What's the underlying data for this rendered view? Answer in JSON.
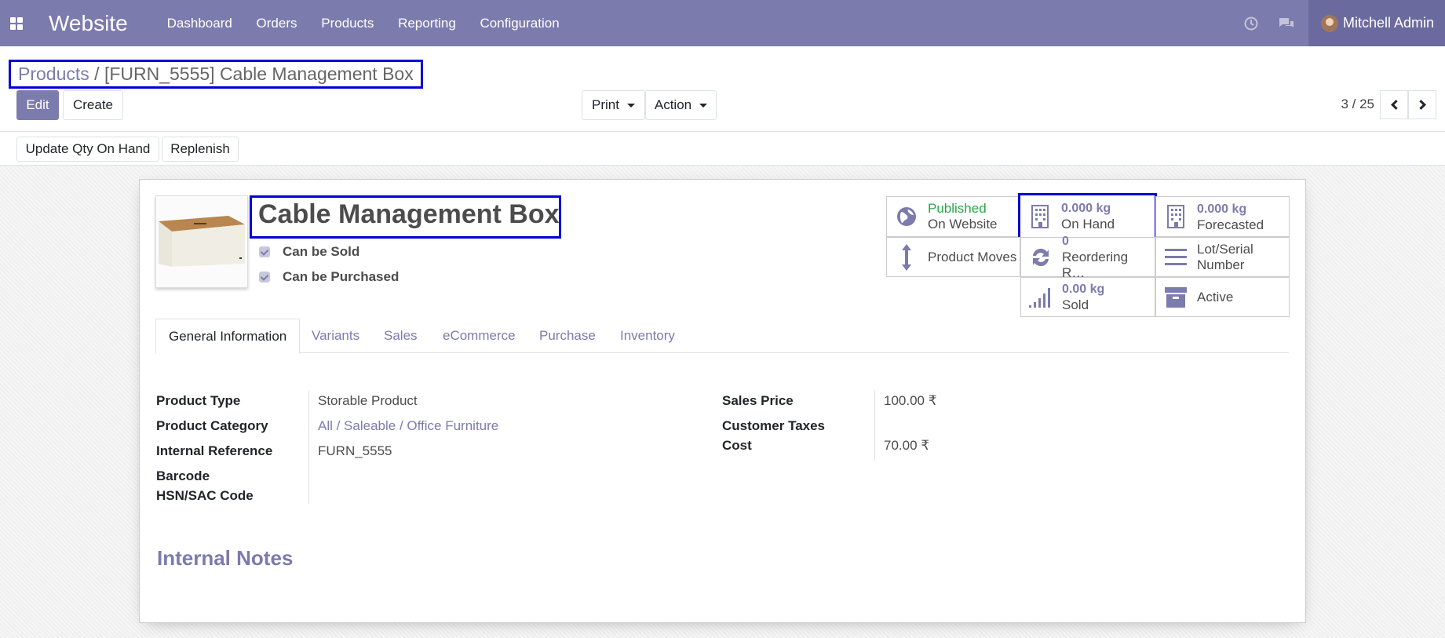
{
  "topbar": {
    "app_name": "Website",
    "nav": [
      "Dashboard",
      "Orders",
      "Products",
      "Reporting",
      "Configuration"
    ],
    "user_name": "Mitchell Admin",
    "color": "#7c7bad"
  },
  "breadcrumb": {
    "parent": "Products",
    "separator": "/",
    "current": "[FURN_5555] Cable Management Box"
  },
  "toolbar": {
    "edit": "Edit",
    "create": "Create",
    "print": "Print",
    "action": "Action",
    "pager": "3 / 25",
    "update_qty": "Update Qty On Hand",
    "replenish": "Replenish"
  },
  "product": {
    "name": "Cable Management Box",
    "can_be_sold": "Can be Sold",
    "can_be_purchased": "Can be Purchased"
  },
  "stats": {
    "published_1": "Published",
    "published_2": "On Website",
    "onhand_val": "0.000 kg",
    "onhand_lbl": "On Hand",
    "forecast_val": "0.000 kg",
    "forecast_lbl": "Forecasted",
    "moves": "Product Moves",
    "reorder_val": "0",
    "reorder_lbl": "Reordering R…",
    "lot_1": "Lot/Serial",
    "lot_2": "Number",
    "sold_val": "0.00 kg",
    "sold_lbl": "Sold",
    "active": "Active"
  },
  "tabs": [
    "General Information",
    "Variants",
    "Sales",
    "eCommerce",
    "Purchase",
    "Inventory"
  ],
  "fields": {
    "product_type_lbl": "Product Type",
    "product_type": "Storable Product",
    "category_lbl": "Product Category",
    "category": "All / Saleable / Office Furniture",
    "internal_ref_lbl": "Internal Reference",
    "internal_ref": "FURN_5555",
    "barcode_lbl": "Barcode",
    "hsn_lbl": "HSN/SAC Code",
    "sales_price_lbl": "Sales Price",
    "sales_price": "100.00 ₹",
    "customer_taxes_lbl": "Customer Taxes",
    "cost_lbl": "Cost",
    "cost": "70.00 ₹"
  },
  "notes_title": "Internal Notes"
}
